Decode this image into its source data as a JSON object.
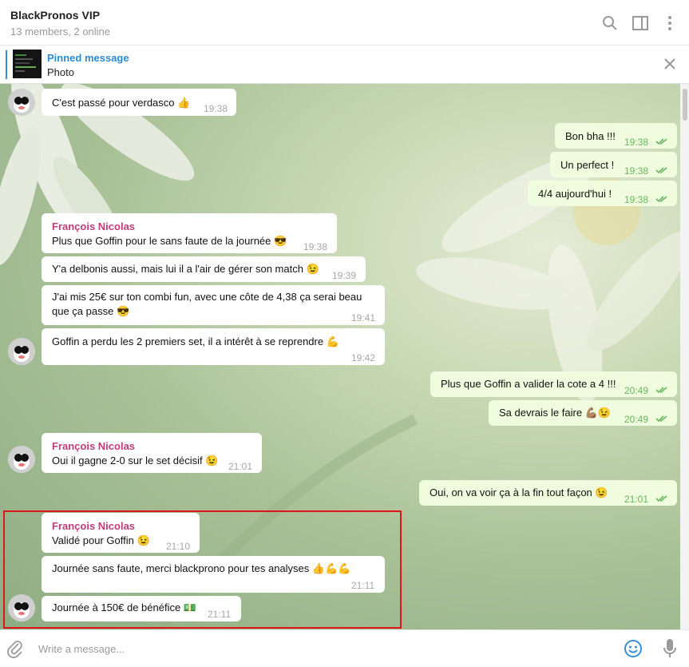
{
  "header": {
    "title": "BlackPronos VIP",
    "subtitle": "13 members, 2 online"
  },
  "pinned": {
    "title": "Pinned message",
    "text": "Photo"
  },
  "messages": {
    "m1": {
      "text": "C'est passé pour verdasco 👍",
      "time": "19:38"
    },
    "m2": {
      "text": "Bon bha !!!",
      "time": "19:38"
    },
    "m3": {
      "text": "Un perfect !",
      "time": "19:38"
    },
    "m4": {
      "text": "4/4 aujourd'hui !",
      "time": "19:38"
    },
    "m5": {
      "sender": "François Nicolas",
      "text": "Plus que Goffin pour le sans faute de la journée 😎",
      "time": "19:38"
    },
    "m6": {
      "text": "Y'a delbonis aussi, mais lui il a l'air de gérer son match 😉",
      "time": "19:39"
    },
    "m7": {
      "line1": "J'ai mis 25€ sur ton combi fun, avec une côte de 4,38 ça serai beau",
      "line2": "que ça passe 😎",
      "time": "19:41"
    },
    "m8": {
      "text": "Goffin a perdu les 2 premiers set, il a intérêt à se reprendre 💪",
      "time": "19:42"
    },
    "m9": {
      "text": "Plus que Goffin a valider la cote a 4 !!!",
      "time": "20:49"
    },
    "m10": {
      "text": "Sa devrais le faire 💪🏽😉",
      "time": "20:49"
    },
    "m11": {
      "sender": "François Nicolas",
      "text": "Oui il gagne 2-0 sur le set décisif 😉",
      "time": "21:01"
    },
    "m12": {
      "text": "Oui, on va voir ça à la fin tout façon 😉",
      "time": "21:01"
    },
    "m13": {
      "sender": "François Nicolas",
      "text": "Validé pour Goffin 😉",
      "time": "21:10"
    },
    "m14": {
      "text": "Journée sans faute, merci blackprono pour tes analyses 👍💪💪",
      "time": "21:11"
    },
    "m15": {
      "text": "Journée à 150€ de bénéfice 💵",
      "time": "21:11"
    }
  },
  "composer": {
    "placeholder": "Write a message..."
  },
  "colors": {
    "accent": "#3a8fd3",
    "sender": "#c03d7b",
    "outgoing_bubble": "#effdde",
    "check": "#69b55e",
    "highlight": "#e0151a"
  },
  "icons": [
    "search-icon",
    "sidebar-toggle-icon",
    "more-vert-icon",
    "close-icon",
    "attach-icon",
    "emoji-icon",
    "microphone-icon",
    "double-check-icon"
  ]
}
